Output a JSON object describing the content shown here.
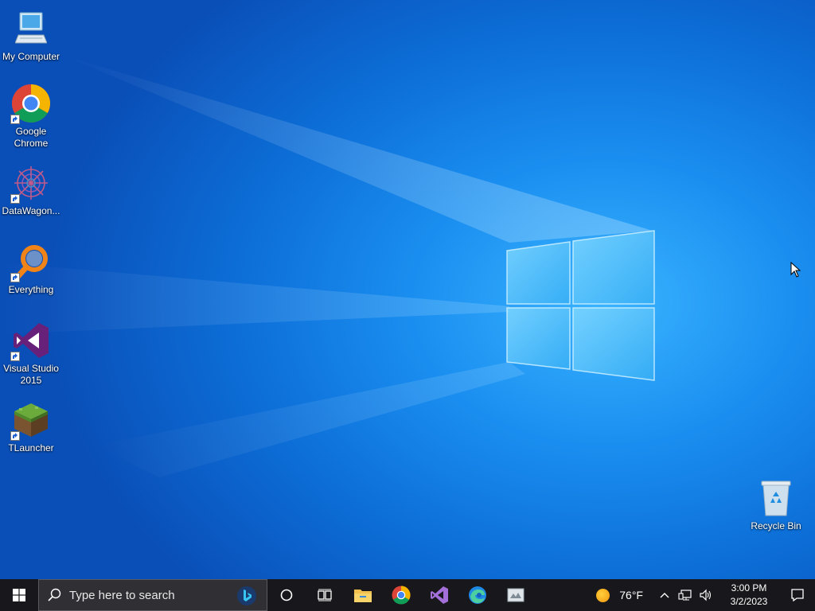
{
  "desktop": {
    "icons": [
      {
        "name": "my-computer",
        "label": "My Computer",
        "icon": "computer-icon"
      },
      {
        "name": "google-chrome",
        "label": "Google\nChrome",
        "icon": "chrome-icon"
      },
      {
        "name": "datawagon",
        "label": "DataWagon...",
        "icon": "datawagon-icon"
      },
      {
        "name": "everything",
        "label": "Everything",
        "icon": "everything-search-icon"
      },
      {
        "name": "visual-studio",
        "label": "Visual Studio\n2015",
        "icon": "visual-studio-icon"
      },
      {
        "name": "tlauncher",
        "label": "TLauncher",
        "icon": "minecraft-grass-block-icon"
      },
      {
        "name": "recycle-bin",
        "label": "Recycle Bin",
        "icon": "recycle-bin-icon"
      }
    ]
  },
  "taskbar": {
    "search_placeholder": "Type here to search",
    "pinned": [
      "start-icon",
      "search-icon",
      "cortana-icon",
      "task-view-icon",
      "file-explorer-icon",
      "chrome-icon",
      "visual-studio-icon",
      "edge-icon",
      "app-icon"
    ],
    "weather": {
      "temp": "76°F",
      "icon": "sun-icon"
    },
    "clock": {
      "time": "3:00 PM",
      "date": "3/2/2023"
    }
  },
  "colors": {
    "taskbar_bg": "#17171c",
    "search_bg": "#2f2f34",
    "wallpaper_blue": "#0d6fd8"
  }
}
